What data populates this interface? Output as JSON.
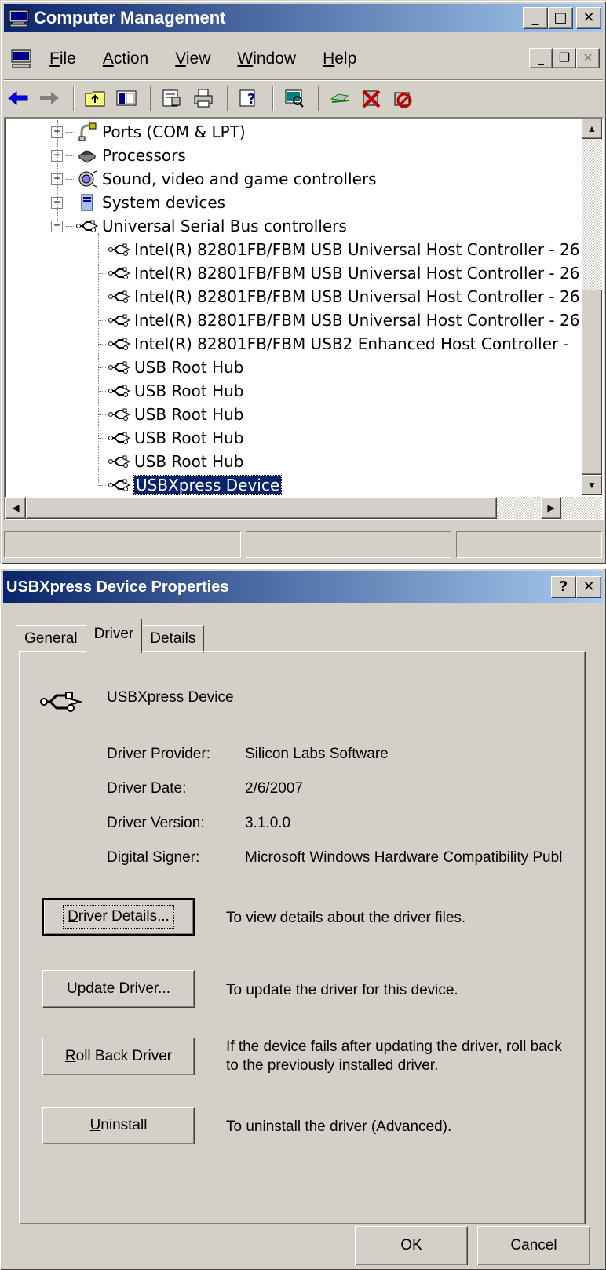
{
  "computer_management": {
    "title": "Computer Management",
    "menu": {
      "file": "File",
      "action": "Action",
      "view": "View",
      "window": "Window",
      "help": "Help"
    },
    "tree": {
      "categories": [
        {
          "label": "Ports (COM & LPT)",
          "icon": "port-icon",
          "expander": "+"
        },
        {
          "label": "Processors",
          "icon": "processor-icon",
          "expander": "+"
        },
        {
          "label": "Sound, video and game controllers",
          "icon": "sound-icon",
          "expander": "+"
        },
        {
          "label": "System devices",
          "icon": "system-devices-icon",
          "expander": "+"
        },
        {
          "label": "Universal Serial Bus controllers",
          "icon": "usb-icon",
          "expander": "−"
        }
      ],
      "usb_children": [
        "Intel(R) 82801FB/FBM USB Universal Host Controller - 26",
        "Intel(R) 82801FB/FBM USB Universal Host Controller - 26",
        "Intel(R) 82801FB/FBM USB Universal Host Controller - 26",
        "Intel(R) 82801FB/FBM USB Universal Host Controller - 26",
        "Intel(R) 82801FB/FBM USB2 Enhanced Host Controller -",
        "USB Root Hub",
        "USB Root Hub",
        "USB Root Hub",
        "USB Root Hub",
        "USB Root Hub",
        "USBXpress Device"
      ],
      "selected": "USBXpress Device"
    }
  },
  "properties": {
    "title": "USBXpress Device Properties",
    "tabs": [
      "General",
      "Driver",
      "Details"
    ],
    "active_tab": "Driver",
    "device_name": "USBXpress Device",
    "driver_provider_label": "Driver Provider:",
    "driver_provider": "Silicon Labs Software",
    "driver_date_label": "Driver Date:",
    "driver_date": "2/6/2007",
    "driver_version_label": "Driver Version:",
    "driver_version": "3.1.0.0",
    "digital_signer_label": "Digital Signer:",
    "digital_signer": "Microsoft Windows Hardware Compatibility Publ",
    "buttons": {
      "driver_details": {
        "pre": "",
        "ul": "D",
        "post": "river Details...",
        "desc": "To view details about the driver files."
      },
      "update_driver": {
        "pre": "Up",
        "ul": "d",
        "post": "ate Driver...",
        "desc": "To update the driver for this device."
      },
      "roll_back": {
        "pre": "",
        "ul": "R",
        "post": "oll Back Driver",
        "desc": "If the device fails after updating the driver, roll back to the previously installed driver."
      },
      "uninstall": {
        "pre": "",
        "ul": "U",
        "post": "ninstall",
        "desc": "To uninstall the driver (Advanced)."
      }
    },
    "ok": "OK",
    "cancel": "Cancel"
  },
  "colors": {
    "titlebar_start": "#0a246a",
    "titlebar_end": "#a6caf0",
    "face": "#d4d0c8",
    "selection": "#0a246a"
  }
}
